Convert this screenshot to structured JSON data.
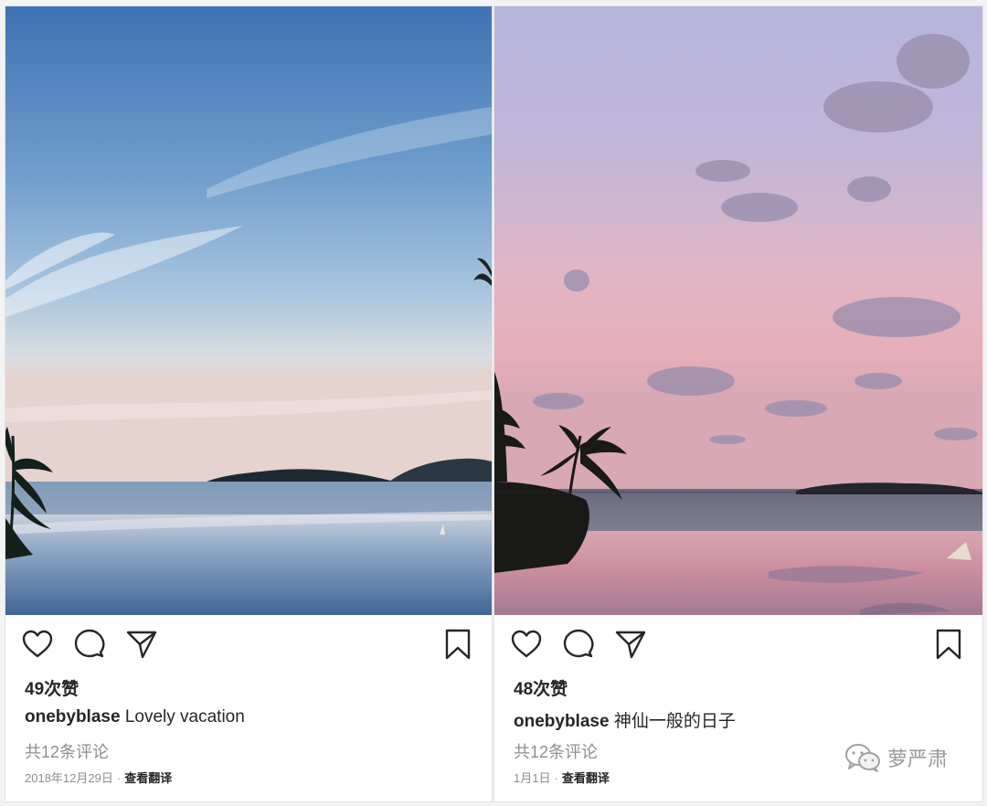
{
  "posts": [
    {
      "likes": "49次赞",
      "username": "onebyblase",
      "caption": "Lovely vacation",
      "comments": "共12条评论",
      "date": "2018年12月29日",
      "separator": "·",
      "translate": "查看翻译",
      "photo_scene": "blue-sky-infinity-pool"
    },
    {
      "likes": "48次赞",
      "username": "onebyblase",
      "caption": "神仙一般的日子",
      "comments": "共12条评论",
      "date": "1月1日",
      "separator": "·",
      "translate": "查看翻译",
      "photo_scene": "pink-sunset-infinity-pool"
    }
  ],
  "icons": [
    "heart-icon",
    "comment-icon",
    "share-icon",
    "bookmark-icon"
  ],
  "watermark": {
    "text": "萝严肃",
    "icon": "wechat-icon"
  },
  "colors": {
    "text": "#262626",
    "muted": "#8e8e8e",
    "background": "#ffffff"
  }
}
